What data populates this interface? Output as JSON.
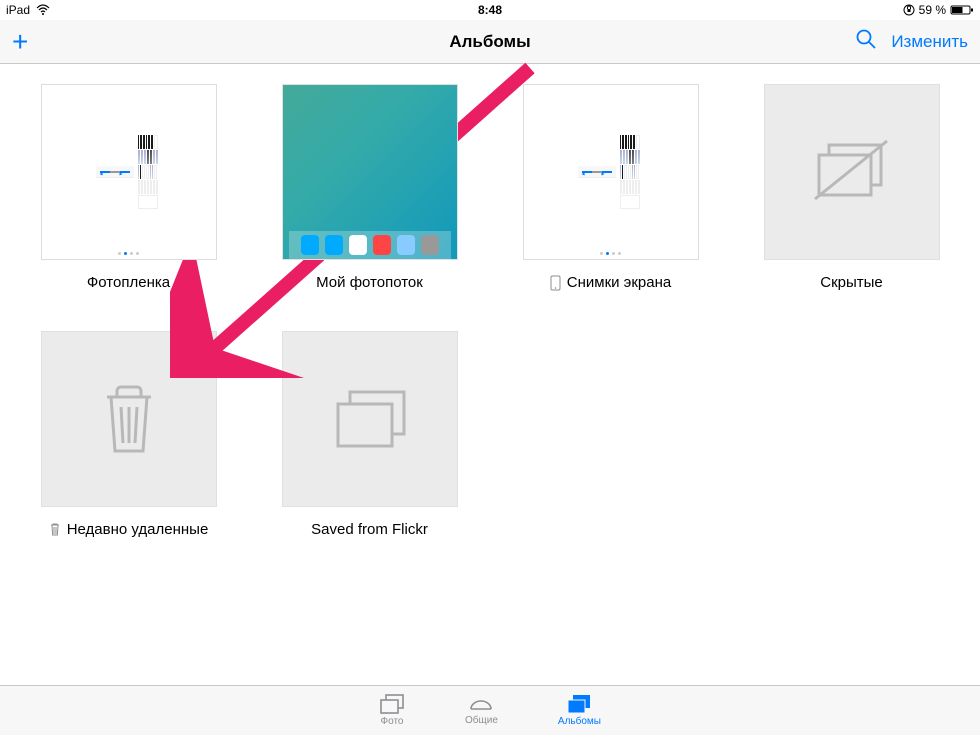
{
  "status": {
    "device": "iPad",
    "time": "8:48",
    "battery_text": "59 %"
  },
  "nav": {
    "title": "Альбомы",
    "add_label": "+",
    "edit_label": "Изменить"
  },
  "albums": [
    {
      "title": "Фотопленка",
      "icon": null
    },
    {
      "title": "Мой фотопоток",
      "icon": null
    },
    {
      "title": "Снимки экрана",
      "icon": "phone"
    },
    {
      "title": "Скрытые",
      "icon": null
    },
    {
      "title": "Недавно удаленные",
      "icon": "trash"
    },
    {
      "title": "Saved from Flickr",
      "icon": null
    }
  ],
  "tabs": {
    "photos": "Фото",
    "shared": "Общие",
    "albums": "Альбомы"
  }
}
